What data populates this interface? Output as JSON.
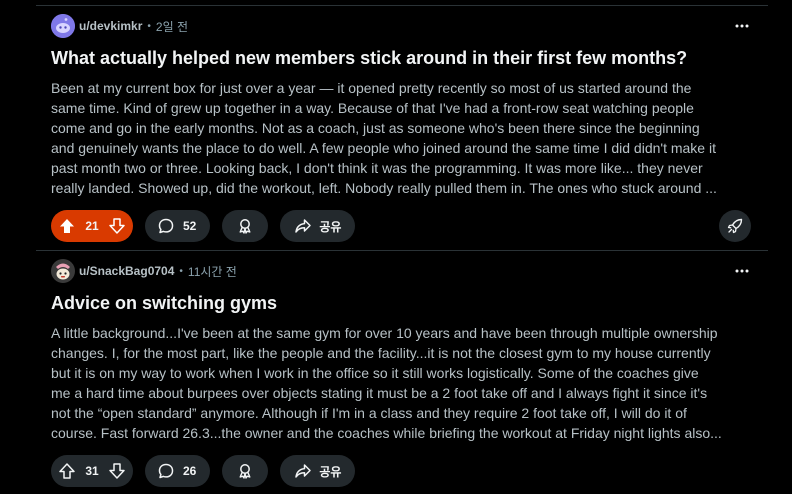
{
  "colors": {
    "background": "#000000",
    "upvote_active": "#d93a00",
    "pill_background": "#23292d",
    "divider": "#2a3236"
  },
  "posts": [
    {
      "username": "u/devkimkr",
      "separator": "•",
      "timestamp": "2일 전",
      "avatar_icon": "reddit-snoo-avatar-icon",
      "title": "What actually helped new members stick around in their first few months?",
      "body_lines": [
        "Been at my current box for just over a year — it opened pretty recently so most of us started around the",
        "same time. Kind of grew up together in a way. Because of that I've had a front-row seat watching people",
        "come and go in the early months. Not as a coach, just as someone who's been there since the beginning",
        "and genuinely wants the place to do well. A few people who joined around the same time I did didn't make it",
        "past month two or three. Looking back, I don't think it was the programming. It was more like... they never",
        "really landed. Showed up, did the workout, left. Nobody really pulled them in. The ones who stuck around ..."
      ],
      "votes": "21",
      "upvoted": true,
      "comments": "52",
      "share_label": "공유"
    },
    {
      "username": "u/SnackBag0704",
      "separator": "•",
      "timestamp": "11시간 전",
      "avatar_icon": "snoo-character-avatar-icon",
      "title": "Advice on switching gyms",
      "body_lines": [
        "A little background...I've been at the same gym for over 10 years and have been through multiple ownership",
        "changes. I, for the most part, like the people and the facility...it is not the closest gym to my house currently",
        "but it is on my way to work when I work in the office so it still works logistically. Some of the coaches give",
        "me a hard time about burpees over objects stating it must be a 2 foot take off and I always fight it since it's",
        "not the “open standard” anymore. Although if I'm in a class and they require 2 foot take off, I will do it of",
        "course. Fast forward 26.3...the owner and the coaches while briefing the workout at Friday night lights also..."
      ],
      "votes": "31",
      "upvoted": false,
      "comments": "26",
      "share_label": "공유"
    }
  ]
}
